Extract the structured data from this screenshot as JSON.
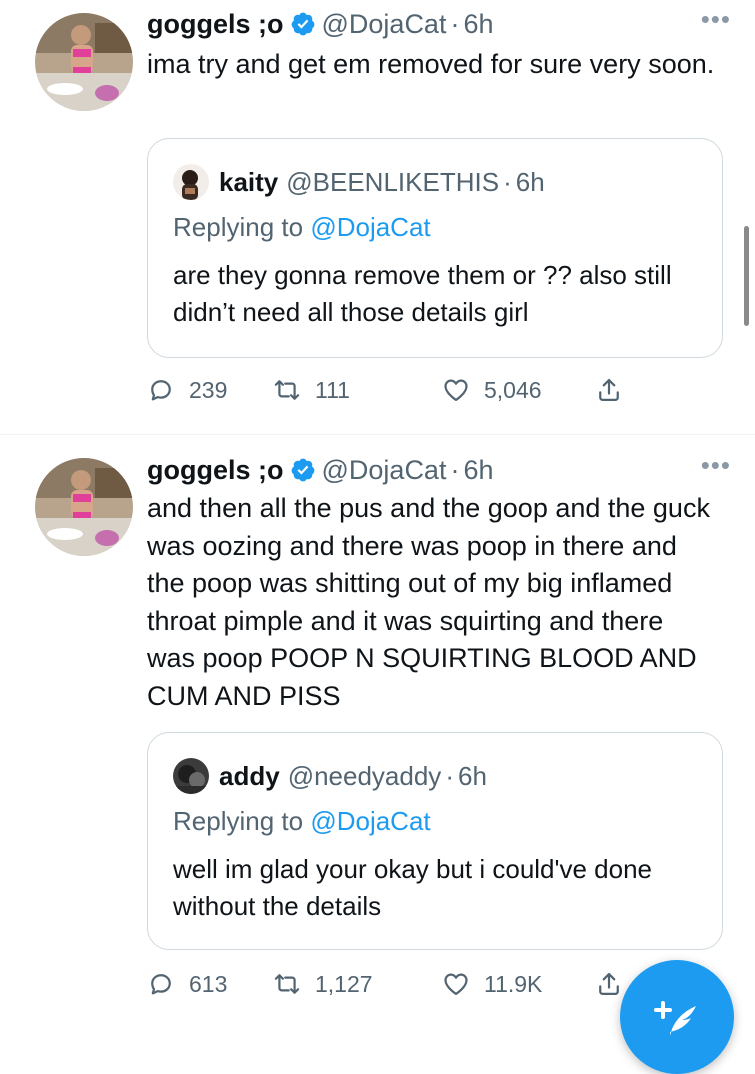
{
  "tweets": [
    {
      "name": "goggels ;o",
      "handle": "@DojaCat",
      "sep": "·",
      "time": "6h",
      "text": "ima try and get em removed for sure very soon.",
      "quote": {
        "name": "kaity",
        "handle": "@BEENLIKETHIS",
        "sep": "·",
        "time": "6h",
        "replying_prefix": "Replying to",
        "replying_to": "@DojaCat",
        "text": "are they gonna remove them or ?? also still didn’t need all those details girl"
      },
      "counts": {
        "replies": "239",
        "retweets": "111",
        "likes": "5,046"
      }
    },
    {
      "name": "goggels ;o",
      "handle": "@DojaCat",
      "sep": "·",
      "time": "6h",
      "text": "and then all the pus and the goop and the guck was oozing and there was poop in there and the poop was shitting out of my big inflamed throat pimple and it was squirting and there was poop POOP N SQUIRTING BLOOD AND CUM AND PISS",
      "quote": {
        "name": "addy",
        "handle": "@needyaddy",
        "sep": "·",
        "time": "6h",
        "replying_prefix": "Replying to",
        "replying_to": "@DojaCat",
        "text": "well im glad your okay but i could've done without the details"
      },
      "counts": {
        "replies": "613",
        "retweets": "1,127",
        "likes": "11.9K"
      }
    }
  ],
  "icons": {
    "more": "more-horizontal-icon",
    "verified": "verified-badge-icon",
    "reply": "reply-bubble-icon",
    "retweet": "retweet-icon",
    "like": "heart-icon",
    "share": "share-icon",
    "compose": "compose-feather-icon"
  },
  "colors": {
    "accent": "#1d9bf0",
    "text": "#0f1419",
    "muted": "#536471",
    "border": "#cfd9de"
  }
}
